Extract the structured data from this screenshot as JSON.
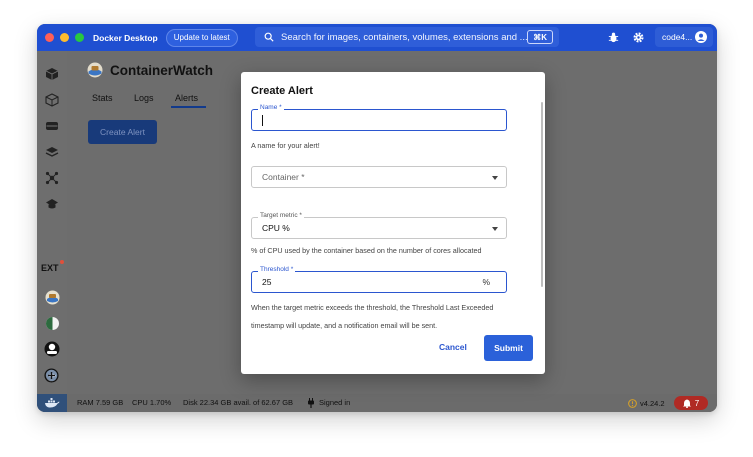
{
  "window": {
    "app_name": "Docker Desktop",
    "update_label": "Update to latest",
    "search_placeholder": "Search for images, containers, volumes, extensions and ...",
    "search_shortcut": "⌘K",
    "user_label": "code4...",
    "traffic_colors": [
      "#ff5f57",
      "#febc2e",
      "#28c840"
    ],
    "titlebar_color": "#1f4fd1"
  },
  "sidebar": {
    "icons": [
      "containers-icon",
      "images-icon",
      "volumes-icon",
      "builds-icon",
      "dev-environments-icon",
      "learning-center-icon"
    ],
    "extensions_label": "EXT",
    "extension_icons": [
      "containerwatch-icon",
      "extension-2-icon",
      "extension-3-icon",
      "extension-4-icon",
      "add-extension-icon"
    ]
  },
  "extension": {
    "title": "ContainerWatch",
    "tabs": [
      "Stats",
      "Logs",
      "Alerts"
    ],
    "active_tab": "Alerts",
    "create_alert_label": "Create Alert"
  },
  "modal": {
    "title": "Create Alert",
    "name": {
      "label": "Name *",
      "value": "",
      "helper": "A name for your alert!"
    },
    "container": {
      "placeholder": "Container *"
    },
    "target_metric": {
      "label": "Target metric *",
      "value": "CPU %",
      "helper": "% of CPU used by the container based on the number of cores allocated"
    },
    "threshold": {
      "label": "Threshold *",
      "value": "25",
      "unit": "%",
      "helper_line1": "When the target metric exceeds the threshold, the Threshold Last Exceeded",
      "helper_line2": "timestamp will update, and a notification email will be sent."
    },
    "cancel_label": "Cancel",
    "submit_label": "Submit"
  },
  "status": {
    "ram": "RAM 7.59 GB",
    "cpu": "CPU 1.70%",
    "disk": "Disk 22.34 GB avail. of 62.67 GB",
    "signed_in": "Signed in",
    "version": "v4.24.2",
    "notifications": "7"
  }
}
